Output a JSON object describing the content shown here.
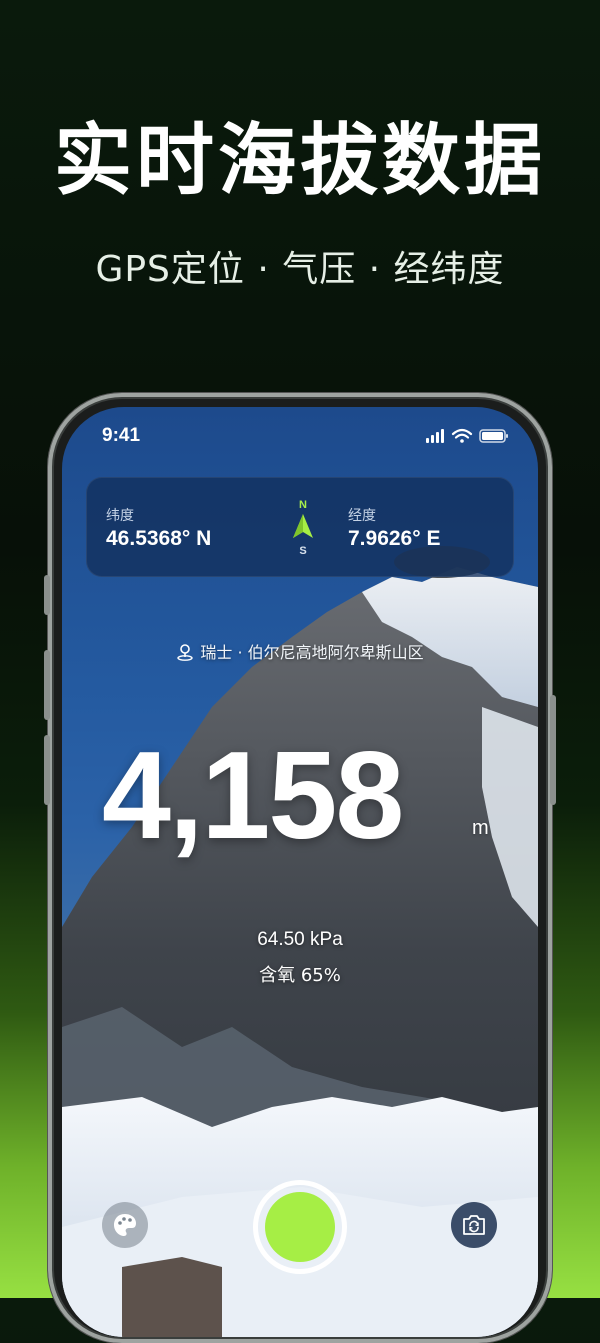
{
  "promo": {
    "headline": "实时海拔数据",
    "subline": "GPS定位 · 气压 · 经纬度"
  },
  "status_bar": {
    "time": "9:41",
    "icons": [
      "signal-icon",
      "wifi-icon",
      "battery-icon"
    ]
  },
  "coordinates": {
    "latitude_label": "纬度",
    "latitude_value": "46.5368° N",
    "longitude_label": "经度",
    "longitude_value": "7.9626° E",
    "compass_north": "N",
    "compass_south": "S"
  },
  "location": {
    "text": "瑞士 · 伯尔尼高地阿尔卑斯山区",
    "icon": "location-pin-icon"
  },
  "reading": {
    "altitude": "4,158",
    "unit": "m",
    "pressure": "64.50 kPa",
    "oxygen": "含氧 65%"
  },
  "controls": {
    "left": "palette-icon",
    "center": "shutter-button",
    "right": "camera-switch-icon"
  },
  "colors": {
    "accent": "#a6ee45",
    "card": "#12305c"
  }
}
